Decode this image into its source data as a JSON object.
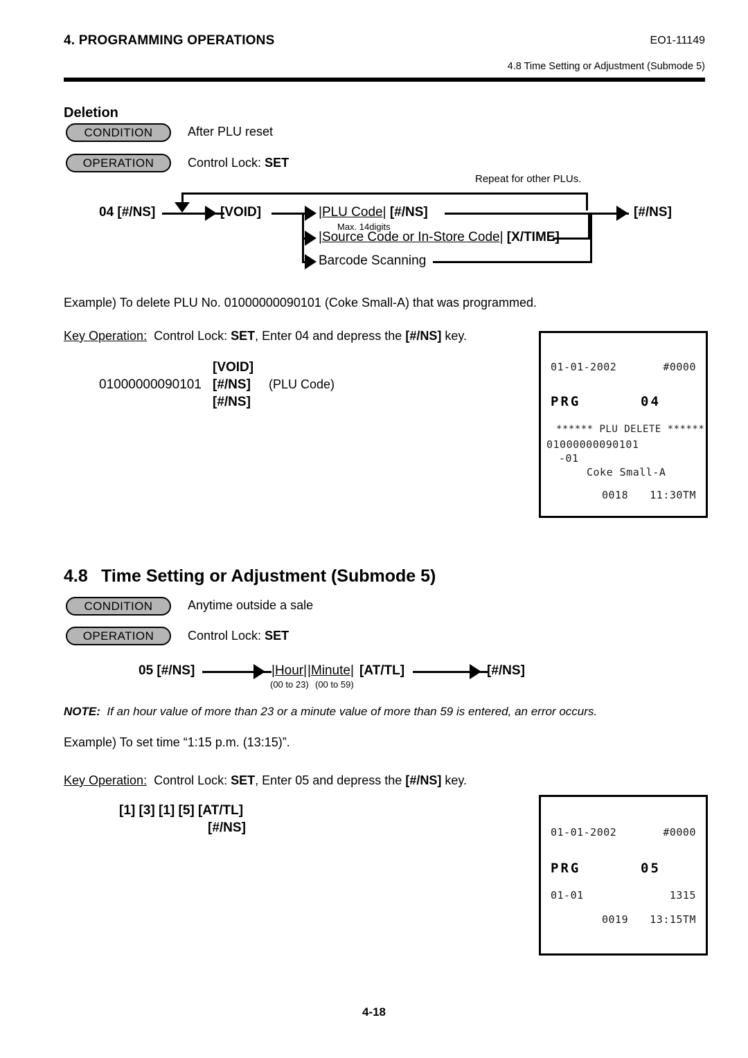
{
  "header": {
    "chapter": "4. PROGRAMMING OPERATIONS",
    "doc_code": "EO1-11149",
    "section_ref": "4.8 Time Setting or Adjustment (Submode 5)"
  },
  "deletion": {
    "title": "Deletion",
    "condition_label": "CONDITION",
    "condition_text": "After PLU reset",
    "operation_label": "OPERATION",
    "operation_text_prefix": "Control Lock: ",
    "operation_text_value": "SET",
    "flow": {
      "repeat_note": "Repeat for other PLUs.",
      "start": "04 [#/NS]",
      "void_key": "[VOID]",
      "branch1_open": "|",
      "branch1_field": "PLU Code",
      "branch1_close": "|",
      "branch1_key": "[#/NS]",
      "branch1_note": "Max. 14digits",
      "branch2_open": "|",
      "branch2_field": "Source Code or In-Store Code",
      "branch2_close": "|",
      "branch2_key": "[X/TIME]",
      "branch3": "Barcode Scanning",
      "end_key": "[#/NS]"
    },
    "example": "Example) To delete PLU No. 01000000090101 (Coke Small-A) that was programmed.",
    "key_op_label": "Key Operation:",
    "key_op_text_a": "Control Lock: ",
    "key_op_text_b": "SET",
    "key_op_text_c": ", Enter 04 and depress the ",
    "key_op_text_d": "[#/NS]",
    "key_op_text_e": " key.",
    "keys": {
      "line1": "[VOID]",
      "line2_code": "01000000090101",
      "line2_key": "[#/NS]",
      "line2_note": "(PLU Code)",
      "line3": "[#/NS]"
    },
    "receipt": {
      "date": "01-01-2002",
      "counter": "#0000",
      "mode": "PRG",
      "submode": "04",
      "title": "****** PLU DELETE ******",
      "plu_code": "01000000090101",
      "plu_suffix": "-01",
      "plu_name": "Coke Small-A",
      "consec": "0018",
      "time": "11:30TM"
    }
  },
  "section48": {
    "number": "4.8",
    "title": "Time Setting or Adjustment (Submode 5)",
    "condition_label": "CONDITION",
    "condition_text": "Anytime outside a sale",
    "operation_label": "OPERATION",
    "operation_text_prefix": "Control Lock: ",
    "operation_text_value": "SET",
    "flow": {
      "start": "05 [#/NS]",
      "hour_open": "|",
      "hour_field": "Hour",
      "hour_close": "|",
      "hour_range": "(00 to 23)",
      "minute_open": "|",
      "minute_field": "Minute",
      "minute_close": "|",
      "minute_range": "(00 to 59)",
      "attl_key": "[AT/TL]",
      "end_key": "[#/NS]"
    },
    "note_label": "NOTE:",
    "note_text": "If an hour value of more than 23 or a minute value of more than 59 is entered, an error occurs.",
    "example": "Example) To set time “1:15 p.m. (13:15)”.",
    "key_op_label": "Key Operation:",
    "key_op_text_a": "Control Lock: ",
    "key_op_text_b": "SET",
    "key_op_text_c": ", Enter 05 and depress the ",
    "key_op_text_d": "[#/NS]",
    "key_op_text_e": " key.",
    "keys": {
      "line1": "[1] [3] [1] [5] [AT/TL]",
      "line2": "[#/NS]"
    },
    "receipt": {
      "date": "01-01-2002",
      "counter": "#0000",
      "mode": "PRG",
      "submode": "05",
      "set_date": "01-01",
      "set_time": "1315",
      "consec": "0019",
      "time": "13:15TM"
    }
  },
  "footer": {
    "page_number": "4-18"
  },
  "colors": {
    "pill_fill": "#b5b5b5",
    "ink": "#000000",
    "receipt_ink": "#1a1a1a"
  }
}
